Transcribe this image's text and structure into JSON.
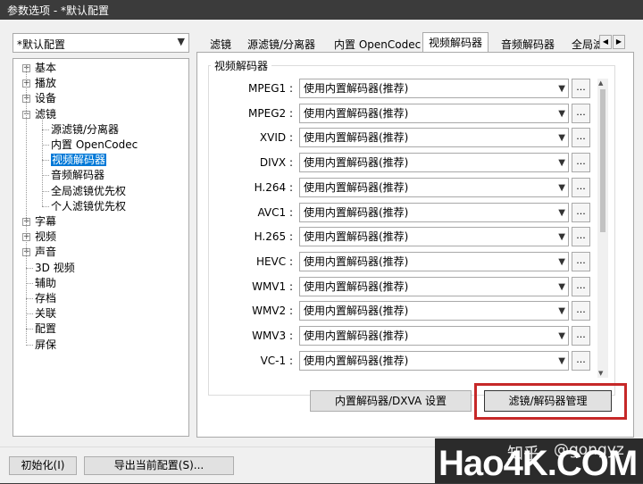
{
  "window": {
    "title": "参数选项 - *默认配置"
  },
  "profile": {
    "selected": "*默认配置"
  },
  "tree": {
    "items": [
      {
        "label": "基本",
        "toggle": "+"
      },
      {
        "label": "播放",
        "toggle": "+"
      },
      {
        "label": "设备",
        "toggle": "+"
      },
      {
        "label": "滤镜",
        "toggle": "−"
      },
      {
        "label": "源滤镜/分离器"
      },
      {
        "label": "内置 OpenCodec"
      },
      {
        "label": "视频解码器"
      },
      {
        "label": "音频解码器"
      },
      {
        "label": "全局滤镜优先权"
      },
      {
        "label": "个人滤镜优先权"
      },
      {
        "label": "字幕",
        "toggle": "+"
      },
      {
        "label": "视频",
        "toggle": "+"
      },
      {
        "label": "声音",
        "toggle": "+"
      },
      {
        "label": "3D 视频"
      },
      {
        "label": "辅助"
      },
      {
        "label": "存档"
      },
      {
        "label": "关联"
      },
      {
        "label": "配置"
      },
      {
        "label": "屏保"
      }
    ],
    "selected": "视频解码器"
  },
  "tabs": [
    "滤镜",
    "源滤镜/分离器",
    "内置 OpenCodec",
    "视频解码器",
    "音频解码器",
    "全局滤"
  ],
  "active_tab": "视频解码器",
  "group": {
    "title": "视频解码器"
  },
  "decoders": [
    {
      "label": "MPEG1 :",
      "value": "使用内置解码器(推荐)"
    },
    {
      "label": "MPEG2 :",
      "value": "使用内置解码器(推荐)"
    },
    {
      "label": "XVID :",
      "value": "使用内置解码器(推荐)"
    },
    {
      "label": "DIVX :",
      "value": "使用内置解码器(推荐)"
    },
    {
      "label": "H.264 :",
      "value": "使用内置解码器(推荐)"
    },
    {
      "label": "AVC1 :",
      "value": "使用内置解码器(推荐)"
    },
    {
      "label": "H.265 :",
      "value": "使用内置解码器(推荐)"
    },
    {
      "label": "HEVC :",
      "value": "使用内置解码器(推荐)"
    },
    {
      "label": "WMV1 :",
      "value": "使用内置解码器(推荐)"
    },
    {
      "label": "WMV2 :",
      "value": "使用内置解码器(推荐)"
    },
    {
      "label": "WMV3 :",
      "value": "使用内置解码器(推荐)"
    },
    {
      "label": "VC-1 :",
      "value": "使用内置解码器(推荐)"
    }
  ],
  "dots_label": "...",
  "buttons": {
    "dxva": "内置解码器/DXVA 设置",
    "manage": "滤镜/解码器管理",
    "init": "初始化(I)",
    "export": "导出当前配置(S)..."
  },
  "watermark": {
    "zhihu": "知乎",
    "handle": "@gongyz",
    "site": "Hao4K.COM"
  },
  "colors": {
    "selection": "#0078d7",
    "highlight_border": "#c62828",
    "titlebar": "#3b3b3b"
  }
}
